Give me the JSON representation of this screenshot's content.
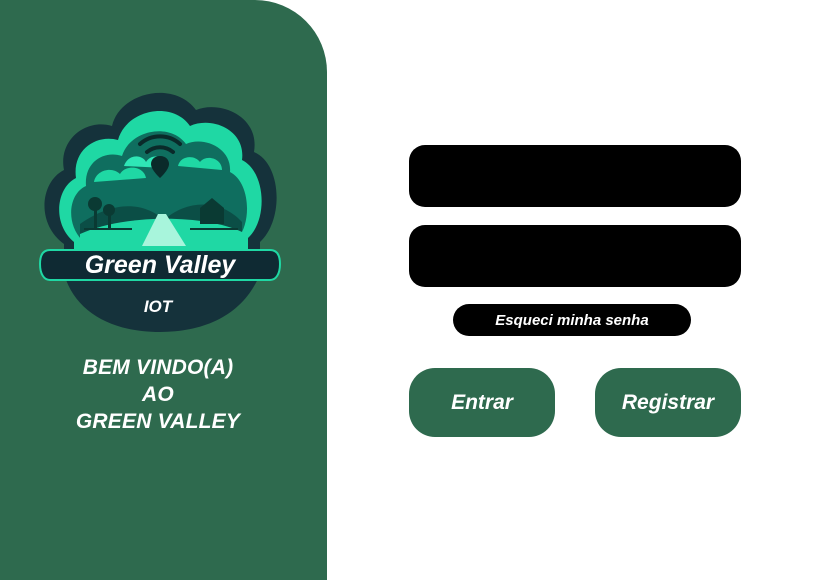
{
  "brand": {
    "logo_name": "Green Valley",
    "logo_sub": "IOT"
  },
  "welcome": {
    "line1": "BEM VINDO(A)",
    "line2": "AO",
    "line3": "GREEN VALLEY"
  },
  "form": {
    "user_value": "",
    "password_value": "",
    "forgot_label": "Esqueci minha senha",
    "enter_label": "Entrar",
    "register_label": "Registrar"
  },
  "colors": {
    "panel": "#2e6a4e",
    "field": "#000000",
    "logo_dark": "#15323b",
    "logo_teal": "#1fd8a4"
  },
  "icons": {
    "logo": "green-valley-logo-icon",
    "wifi": "wifi-pin-icon"
  }
}
